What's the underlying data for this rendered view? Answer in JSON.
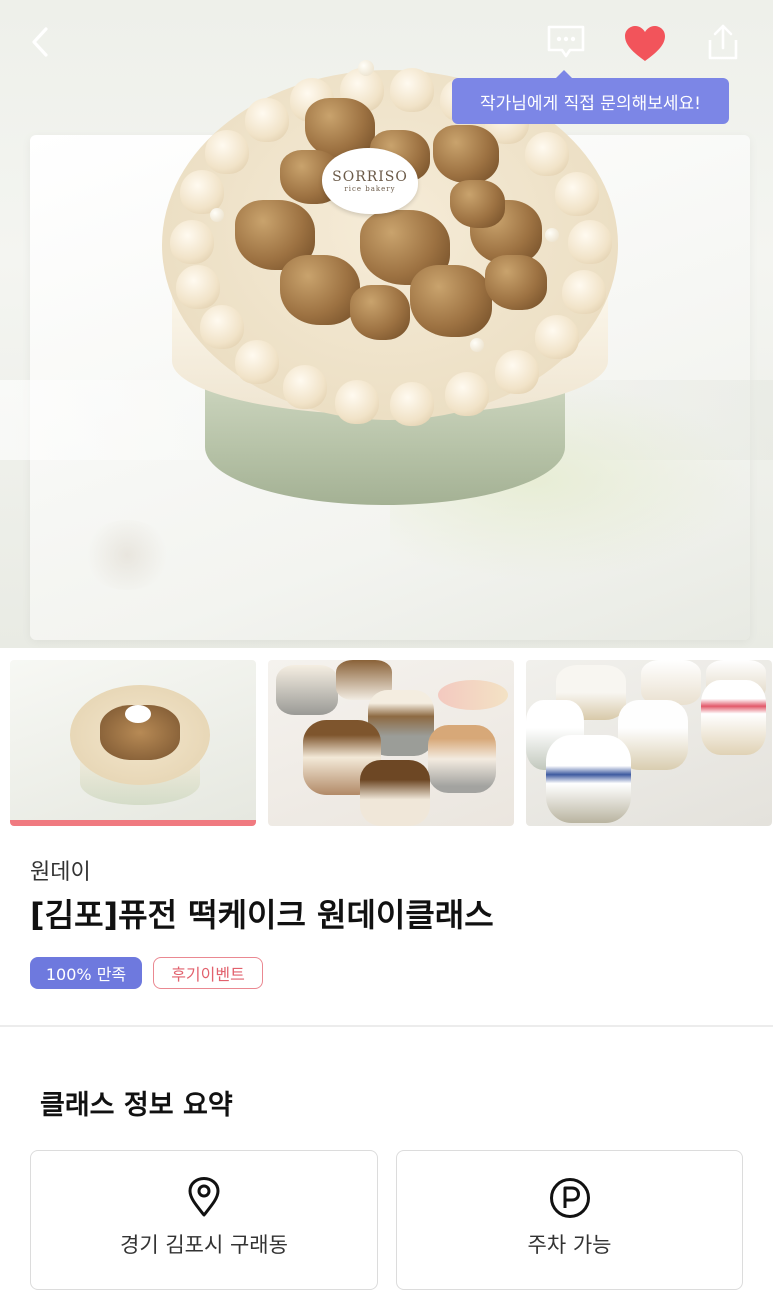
{
  "header": {
    "back_icon": "chevron-left-icon",
    "chat_icon": "chat-bubble-icon",
    "like_icon": "heart-icon",
    "share_icon": "share-icon",
    "tooltip": "작가님에게 직접 문의해보세요!",
    "heart_color": "#f2545b"
  },
  "hero": {
    "logo_text": "SORRISO",
    "logo_sub": "rice bakery"
  },
  "gallery": {
    "active_index": 0,
    "active_color": "#f07a80",
    "thumbnails": [
      "cake-photo-1",
      "cake-photo-2",
      "cake-photo-3"
    ]
  },
  "product": {
    "shop_name": "원데이",
    "title": "[김포]퓨전 떡케이크 원데이클래스",
    "badges": [
      {
        "label": "100% 만족",
        "color": "#6e79de"
      },
      {
        "label": "후기이벤트",
        "color": "#e2616d"
      }
    ]
  },
  "summary": {
    "heading": "클래스 정보 요약",
    "items": [
      {
        "icon": "location-pin-icon",
        "label": "경기 김포시 구래동"
      },
      {
        "icon": "parking-icon",
        "label": "주차 가능"
      }
    ]
  }
}
